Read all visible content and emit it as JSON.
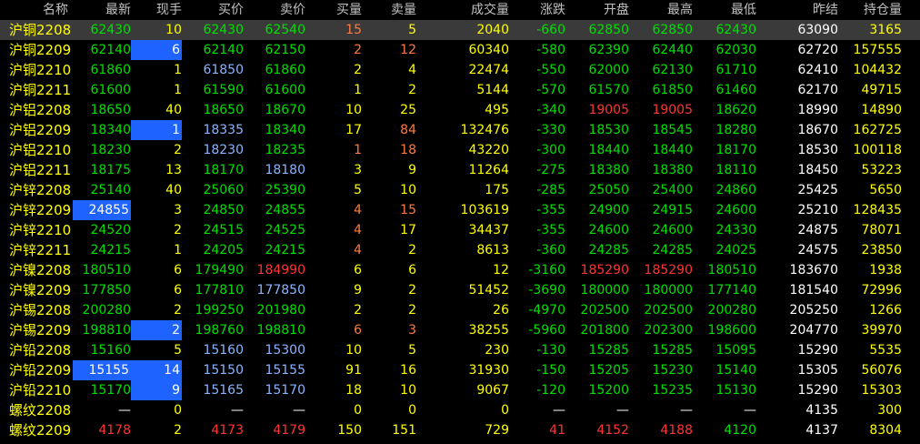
{
  "headers": {
    "name": "名称",
    "last": "最新",
    "hand": "现手",
    "bid": "买价",
    "ask": "卖价",
    "bidvol": "买量",
    "askvol": "卖量",
    "vol": "成交量",
    "change": "涨跌",
    "open": "开盘",
    "high": "最高",
    "low": "最低",
    "prev": "昨结",
    "oi": "持仓量"
  },
  "colors": {
    "up": "#ff3333",
    "down": "#00e000",
    "flat": "#ffffff",
    "yellow": "#ffff00",
    "blueish": "#8ab4ff",
    "highlight": "#1e63ff"
  },
  "rows": [
    {
      "name": "沪铜2208",
      "last": "62430",
      "hand": "10",
      "bid": "62430",
      "ask": "62540",
      "bidvol": "15",
      "askvol": "5",
      "vol": "2040",
      "change": "-660",
      "open": "62850",
      "high": "62850",
      "low": "62430",
      "prev": "63090",
      "oi": "3165"
    },
    {
      "name": "沪铜2209",
      "last": "62140",
      "hand": "6",
      "bid": "62140",
      "ask": "62150",
      "bidvol": "2",
      "askvol": "12",
      "vol": "60340",
      "change": "-580",
      "open": "62390",
      "high": "62440",
      "low": "62030",
      "prev": "62720",
      "oi": "157555"
    },
    {
      "name": "沪铜2210",
      "last": "61860",
      "hand": "1",
      "bid": "61850",
      "ask": "61860",
      "bidvol": "2",
      "askvol": "4",
      "vol": "22474",
      "change": "-550",
      "open": "62000",
      "high": "62130",
      "low": "61710",
      "prev": "62410",
      "oi": "104432"
    },
    {
      "name": "沪铜2211",
      "last": "61600",
      "hand": "1",
      "bid": "61590",
      "ask": "61600",
      "bidvol": "1",
      "askvol": "2",
      "vol": "5144",
      "change": "-570",
      "open": "61570",
      "high": "61850",
      "low": "61460",
      "prev": "62170",
      "oi": "49715"
    },
    {
      "name": "沪铝2208",
      "last": "18650",
      "hand": "40",
      "bid": "18650",
      "ask": "18670",
      "bidvol": "10",
      "askvol": "25",
      "vol": "495",
      "change": "-340",
      "open": "19005",
      "high": "19005",
      "low": "18620",
      "prev": "18990",
      "oi": "14890"
    },
    {
      "name": "沪铝2209",
      "last": "18340",
      "hand": "1",
      "bid": "18335",
      "ask": "18340",
      "bidvol": "17",
      "askvol": "84",
      "vol": "132476",
      "change": "-330",
      "open": "18530",
      "high": "18545",
      "low": "18280",
      "prev": "18670",
      "oi": "162725"
    },
    {
      "name": "沪铝2210",
      "last": "18230",
      "hand": "2",
      "bid": "18230",
      "ask": "18235",
      "bidvol": "1",
      "askvol": "18",
      "vol": "43220",
      "change": "-300",
      "open": "18440",
      "high": "18440",
      "low": "18170",
      "prev": "18530",
      "oi": "100118"
    },
    {
      "name": "沪铝2211",
      "last": "18175",
      "hand": "13",
      "bid": "18170",
      "ask": "18180",
      "bidvol": "3",
      "askvol": "9",
      "vol": "11264",
      "change": "-275",
      "open": "18380",
      "high": "18380",
      "low": "18110",
      "prev": "18450",
      "oi": "53223"
    },
    {
      "name": "沪锌2208",
      "last": "25140",
      "hand": "40",
      "bid": "25060",
      "ask": "25390",
      "bidvol": "5",
      "askvol": "10",
      "vol": "175",
      "change": "-285",
      "open": "25050",
      "high": "25400",
      "low": "24860",
      "prev": "25425",
      "oi": "5650"
    },
    {
      "name": "沪锌2209",
      "last": "24855",
      "hand": "3",
      "bid": "24850",
      "ask": "24855",
      "bidvol": "4",
      "askvol": "15",
      "vol": "103619",
      "change": "-355",
      "open": "24900",
      "high": "24915",
      "low": "24600",
      "prev": "25210",
      "oi": "128435"
    },
    {
      "name": "沪锌2210",
      "last": "24520",
      "hand": "2",
      "bid": "24515",
      "ask": "24525",
      "bidvol": "4",
      "askvol": "17",
      "vol": "34437",
      "change": "-355",
      "open": "24600",
      "high": "24600",
      "low": "24330",
      "prev": "24875",
      "oi": "78071"
    },
    {
      "name": "沪锌2211",
      "last": "24215",
      "hand": "1",
      "bid": "24205",
      "ask": "24215",
      "bidvol": "4",
      "askvol": "2",
      "vol": "8613",
      "change": "-360",
      "open": "24285",
      "high": "24285",
      "low": "24025",
      "prev": "24575",
      "oi": "23850"
    },
    {
      "name": "沪镍2208",
      "last": "180510",
      "hand": "6",
      "bid": "179490",
      "ask": "184990",
      "bidvol": "6",
      "askvol": "6",
      "vol": "12",
      "change": "-3160",
      "open": "185290",
      "high": "185290",
      "low": "180510",
      "prev": "183670",
      "oi": "1938"
    },
    {
      "name": "沪镍2209",
      "last": "177850",
      "hand": "6",
      "bid": "177810",
      "ask": "177850",
      "bidvol": "9",
      "askvol": "2",
      "vol": "51452",
      "change": "-3690",
      "open": "180000",
      "high": "180000",
      "low": "177140",
      "prev": "181540",
      "oi": "72996"
    },
    {
      "name": "沪锡2208",
      "last": "200280",
      "hand": "2",
      "bid": "199250",
      "ask": "201980",
      "bidvol": "2",
      "askvol": "2",
      "vol": "26",
      "change": "-4970",
      "open": "202500",
      "high": "202500",
      "low": "200280",
      "prev": "205250",
      "oi": "1266"
    },
    {
      "name": "沪锡2209",
      "last": "198810",
      "hand": "2",
      "bid": "198760",
      "ask": "198810",
      "bidvol": "6",
      "askvol": "3",
      "vol": "38255",
      "change": "-5960",
      "open": "201800",
      "high": "202300",
      "low": "198600",
      "prev": "204770",
      "oi": "39970"
    },
    {
      "name": "沪铅2208",
      "last": "15160",
      "hand": "5",
      "bid": "15160",
      "ask": "15300",
      "bidvol": "10",
      "askvol": "5",
      "vol": "230",
      "change": "-130",
      "open": "15285",
      "high": "15285",
      "low": "15095",
      "prev": "15290",
      "oi": "5535"
    },
    {
      "name": "沪铅2209",
      "last": "15155",
      "hand": "14",
      "bid": "15150",
      "ask": "15155",
      "bidvol": "91",
      "askvol": "16",
      "vol": "31930",
      "change": "-150",
      "open": "15205",
      "high": "15230",
      "low": "15140",
      "prev": "15305",
      "oi": "56076"
    },
    {
      "name": "沪铅2210",
      "last": "15170",
      "hand": "9",
      "bid": "15165",
      "ask": "15170",
      "bidvol": "18",
      "askvol": "10",
      "vol": "9067",
      "change": "-120",
      "open": "15200",
      "high": "15235",
      "low": "15130",
      "prev": "15290",
      "oi": "15303"
    },
    {
      "name": "螺纹2208",
      "last": "—",
      "hand": "0",
      "bid": "—",
      "ask": "—",
      "bidvol": "0",
      "askvol": "0",
      "vol": "0",
      "change": "—",
      "open": "—",
      "high": "—",
      "low": "—",
      "prev": "4135",
      "oi": "300"
    },
    {
      "name": "螺纹2209",
      "last": "4178",
      "hand": "2",
      "bid": "4173",
      "ask": "4179",
      "bidvol": "150",
      "askvol": "151",
      "vol": "729",
      "change": "41",
      "open": "4152",
      "high": "4188",
      "low": "4120",
      "prev": "4137",
      "oi": "8304"
    }
  ]
}
